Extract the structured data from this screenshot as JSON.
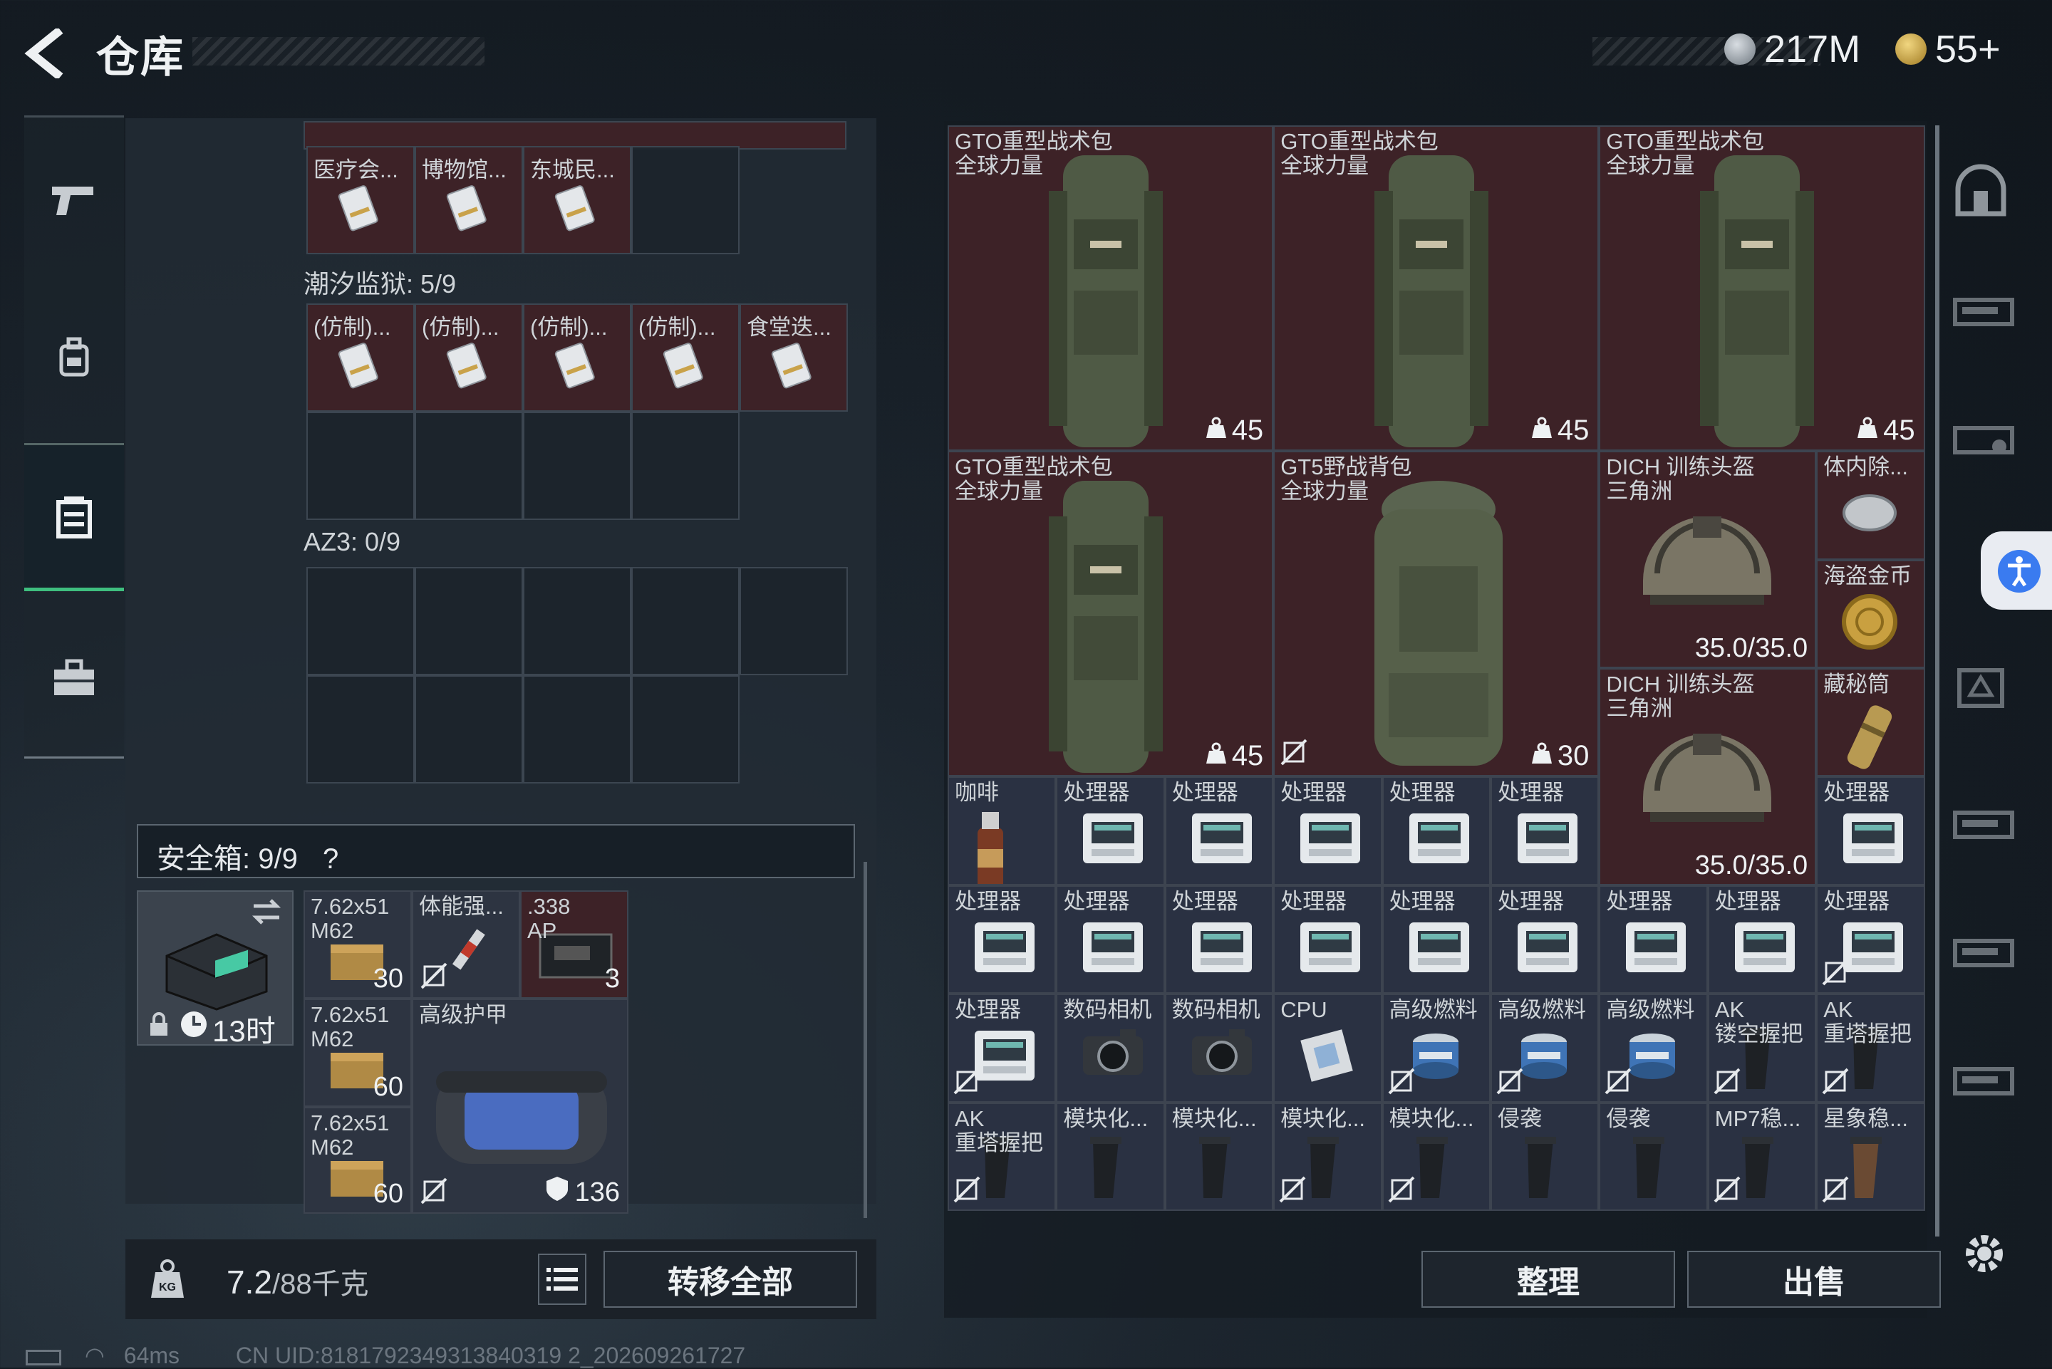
{
  "header": {
    "title": "仓库",
    "currency_silver": "217M",
    "currency_gold": "55+"
  },
  "nav": {
    "items": [
      "weapon",
      "backpack",
      "stash",
      "toolbox"
    ],
    "active": "stash"
  },
  "stash": {
    "top_partial_items": [
      {
        "label": "医疗会..."
      },
      {
        "label": "博物馆..."
      },
      {
        "label": "东城民..."
      }
    ],
    "section_tide": {
      "label": "潮汐监狱: 5/9",
      "items": [
        {
          "label": "(仿制)..."
        },
        {
          "label": "(仿制)..."
        },
        {
          "label": "(仿制)..."
        },
        {
          "label": "(仿制)..."
        },
        {
          "label": "食堂迭..."
        }
      ]
    },
    "section_az3": {
      "label": "AZ3: 0/9"
    },
    "safe_box": {
      "title": "安全箱:  9/9",
      "help": "?",
      "timer": "13时",
      "items": [
        {
          "label": "7.62x51\nM62",
          "count": "30"
        },
        {
          "label": "体能强...",
          "count": ""
        },
        {
          "label": ".338\nAP",
          "count": "3"
        },
        {
          "label": "7.62x51\nM62",
          "count": "60"
        },
        {
          "label": "高级护甲",
          "count": "136"
        },
        {
          "label": "7.62x51\nM62",
          "count": "60"
        }
      ]
    },
    "weight": "7.2",
    "weight_unit": "/88千克",
    "transfer_all": "转移全部"
  },
  "grid": {
    "backpacks": [
      {
        "label": "GTO重型战术包\n全球力量",
        "count": "45"
      },
      {
        "label": "GTO重型战术包\n全球力量",
        "count": "45"
      },
      {
        "label": "GTO重型战术包\n全球力量",
        "count": "45"
      },
      {
        "label": "GTO重型战术包\n全球力量",
        "count": "45"
      },
      {
        "label": "GT5野战背包\n全球力量",
        "count": "30"
      }
    ],
    "helmets": [
      {
        "label": "DICH 训练头盔\n三角洲",
        "durability": "35.0/35.0"
      },
      {
        "label": "DICH 训练头盔\n三角洲",
        "durability": "35.0/35.0"
      }
    ],
    "small": [
      {
        "label": "体内除..."
      },
      {
        "label": "海盗金币"
      },
      {
        "label": "藏秘筒"
      },
      {
        "label": "咖啡"
      },
      {
        "label": "处理器"
      },
      {
        "label": "数码相机"
      },
      {
        "label": "CPU"
      },
      {
        "label": "高级燃料"
      },
      {
        "label": "AK\n镂空握把"
      },
      {
        "label": "AK\n重塔握把"
      },
      {
        "label": "模块化..."
      },
      {
        "label": "侵袭"
      },
      {
        "label": "MP7稳..."
      },
      {
        "label": "星象稳..."
      }
    ]
  },
  "actions": {
    "sort": "整理",
    "sell": "出售"
  },
  "status": {
    "ping": "64ms",
    "uid": "CN UID:8181792349313840319 2_202609261727"
  }
}
